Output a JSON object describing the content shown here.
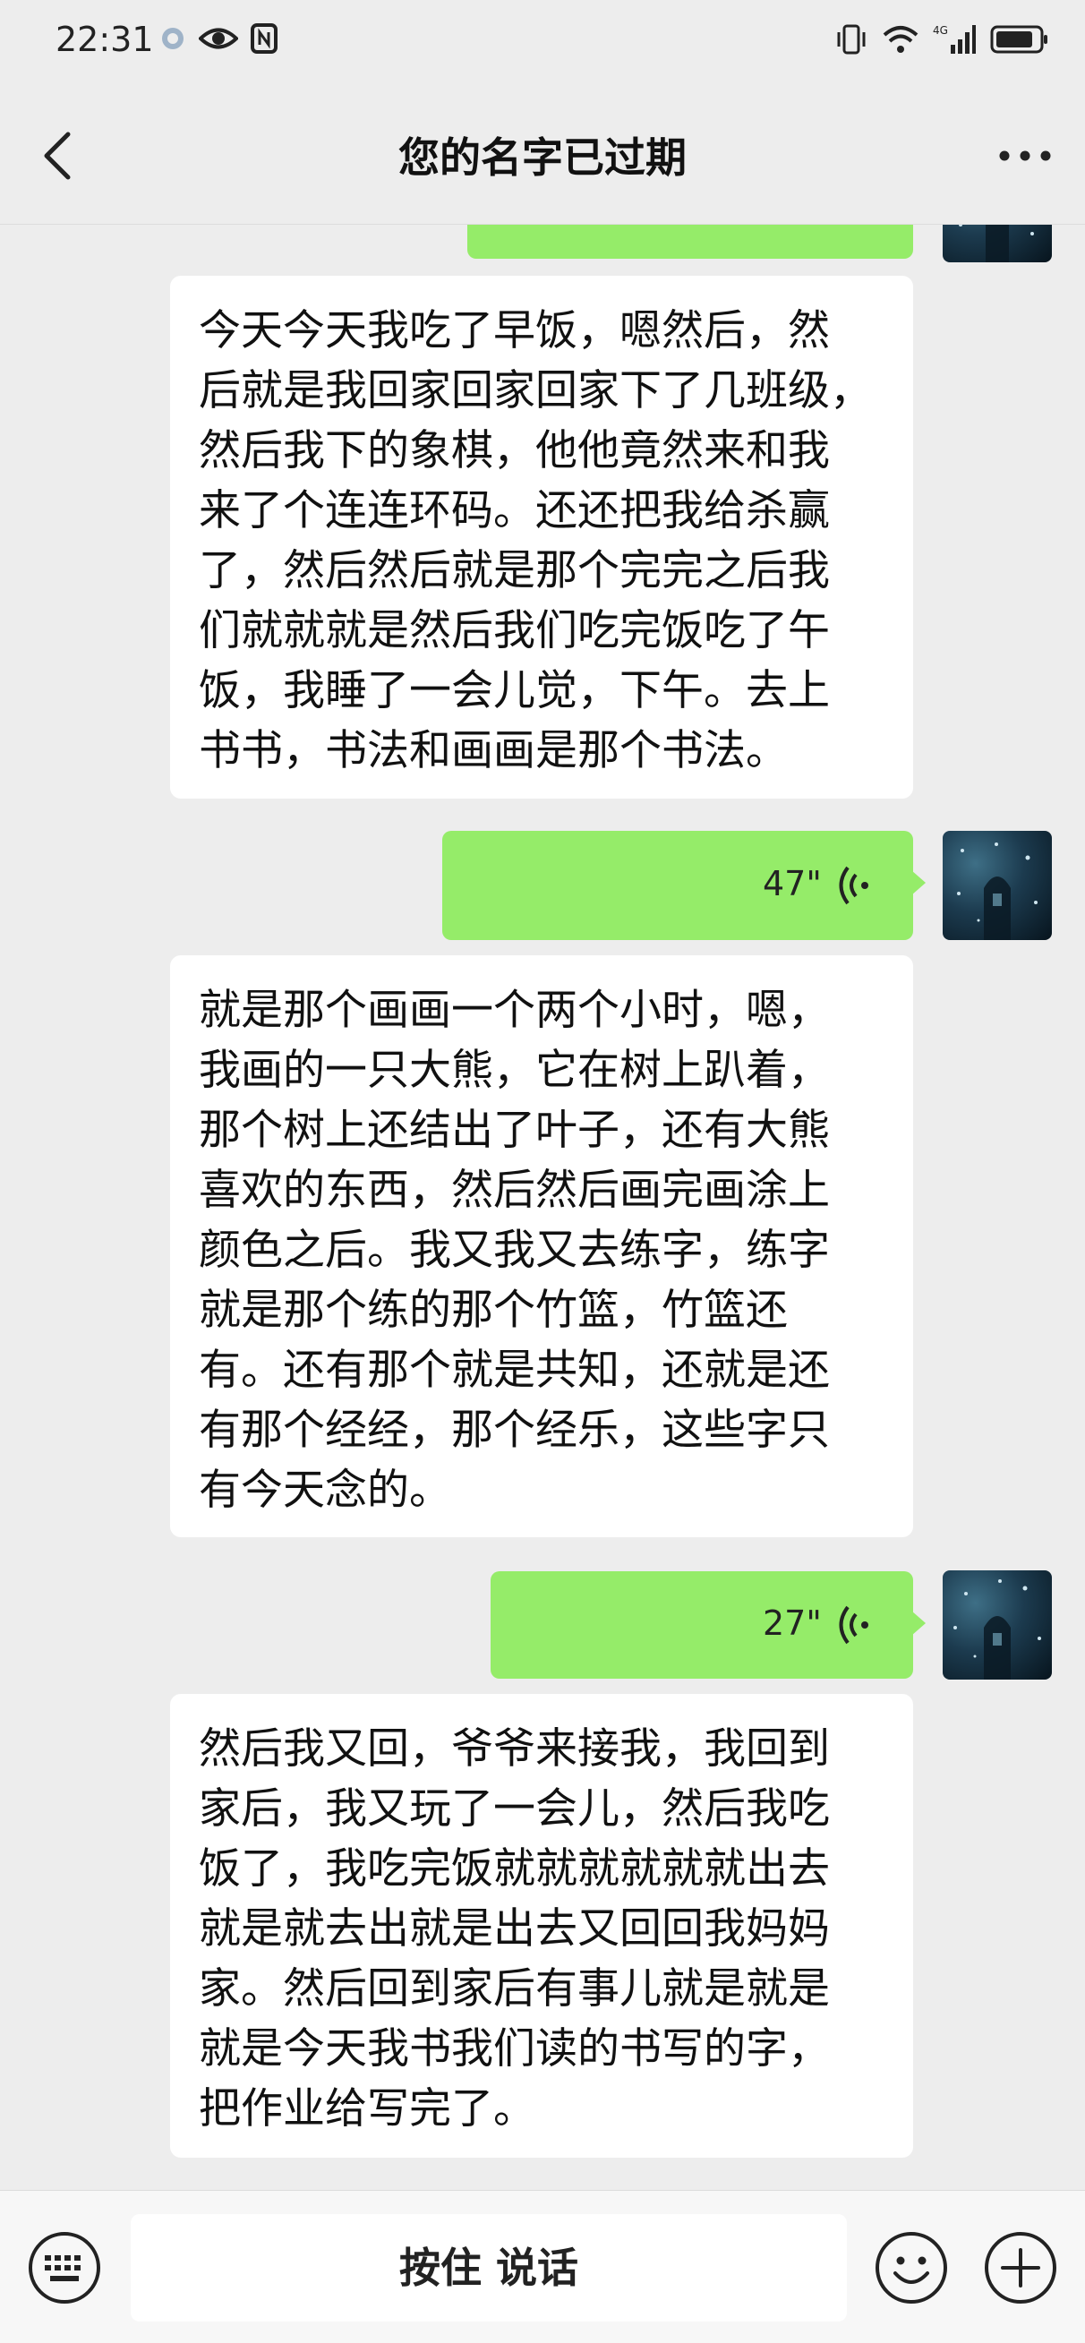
{
  "status_bar": {
    "time": "22:31",
    "network": "4G"
  },
  "header": {
    "title": "您的名字已过期"
  },
  "messages": {
    "text1": "今天今天我吃了早饭，嗯然后，然\n后就是我回家回家回家下了几班级，\n然后我下的象棋，他他竟然来和我\n来了个连连环码。还还把我给杀赢\n了，然后然后就是那个完完之后我\n们就就就是然后我们吃完饭吃了午\n饭，我睡了一会儿觉，下午。去上\n书书，书法和画画是那个书法。",
    "voice1": {
      "duration": "47\""
    },
    "text2": "就是那个画画一个两个小时，嗯，\n我画的一只大熊，它在树上趴着，\n那个树上还结出了叶子，还有大熊\n喜欢的东西，然后然后画完画涂上\n颜色之后。我又我又去练字，练字\n就是那个练的那个竹篮，竹篮还\n有。还有那个就是共知，还就是还\n有那个经经，那个经乐，这些字只\n有今天念的。",
    "voice2": {
      "duration": "27\""
    },
    "text3": "然后我又回，爷爷来接我，我回到\n家后，我又玩了一会儿，然后我吃\n饭了，我吃完饭就就就就就就出去\n就是就去出就是出去又回回我妈妈\n家。然后回到家后有事儿就是就是\n就是今天我书我们读的书写的字，\n把作业给写完了。"
  },
  "input_bar": {
    "hold_to_talk": "按住 说话"
  },
  "icons": {
    "back": "chevron-left-icon",
    "more": "ellipsis-icon",
    "keyboard": "keyboard-icon",
    "emoji": "smiley-icon",
    "plus": "plus-circle-icon",
    "voice": "voice-wave-icon"
  },
  "colors": {
    "self_bubble": "#95ec69",
    "other_bubble": "#ffffff",
    "background": "#ededed"
  }
}
